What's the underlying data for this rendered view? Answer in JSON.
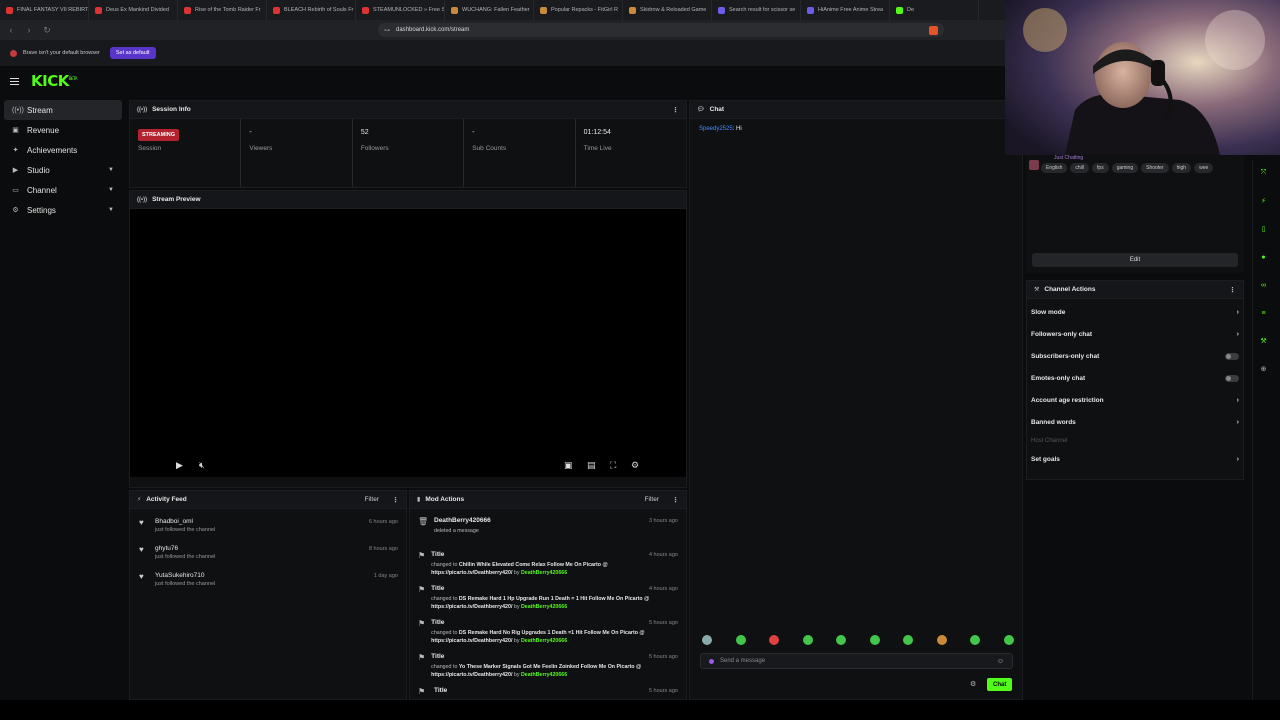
{
  "browser": {
    "tabs": [
      {
        "label": "FINAL FANTASY VII REBIRT",
        "color": "#d33"
      },
      {
        "label": "Deus Ex Mankind Divided",
        "color": "#d33"
      },
      {
        "label": "Rise of the Tomb Raider Fr",
        "color": "#d33"
      },
      {
        "label": "BLEACH Rebirth of Souls Fr",
        "color": "#d33"
      },
      {
        "label": "STEAMUNLOCKED » Free S",
        "color": "#d33"
      },
      {
        "label": "WUCHANG: Fallen Feather",
        "color": "#c98a3a"
      },
      {
        "label": "Popular Repacks - FitGirl R",
        "color": "#c98a3a"
      },
      {
        "label": "Skidrow & Reloaded Game",
        "color": "#c98a3a"
      },
      {
        "label": "Search result for scissor se",
        "color": "#6c5ce7"
      },
      {
        "label": "HiAnime Free Anime Strea",
        "color": "#6c5ce7"
      },
      {
        "label": "De",
        "color": "#53fc18"
      }
    ],
    "url": "dashboard.kick.com/stream",
    "notice": "Brave isn't your default browser",
    "set_default": "Set as default"
  },
  "header": {
    "logo": "KICK",
    "logo_beta": "BETA"
  },
  "sidebar": {
    "items": [
      {
        "label": "Stream",
        "icon": "broadcast-icon",
        "glyph": "((•))",
        "active": true,
        "chevron": false
      },
      {
        "label": "Revenue",
        "icon": "wallet-icon",
        "glyph": "▣",
        "active": false,
        "chevron": false
      },
      {
        "label": "Achievements",
        "icon": "trophy-icon",
        "glyph": "✦",
        "active": false,
        "chevron": false
      },
      {
        "label": "Studio",
        "icon": "camera-icon",
        "glyph": "▶",
        "active": false,
        "chevron": true
      },
      {
        "label": "Channel",
        "icon": "tv-icon",
        "glyph": "▭",
        "active": false,
        "chevron": true
      },
      {
        "label": "Settings",
        "icon": "gear-icon",
        "glyph": "⚙",
        "active": false,
        "chevron": true
      }
    ]
  },
  "session": {
    "title": "Session Info",
    "stats": [
      {
        "value": "STREAMING",
        "label": "Session",
        "badge": true
      },
      {
        "value": "-",
        "label": "Viewers",
        "badge": false
      },
      {
        "value": "52",
        "label": "Followers",
        "badge": false
      },
      {
        "value": "-",
        "label": "Sub Counts",
        "badge": false
      },
      {
        "value": "01:12:54",
        "label": "Time Live",
        "badge": false
      }
    ]
  },
  "preview": {
    "title": "Stream Preview"
  },
  "activity": {
    "title": "Activity Feed",
    "filter": "Filter",
    "items": [
      {
        "name": "Bhadboi_oml",
        "sub": "just followed the channel",
        "time": "6 hours ago"
      },
      {
        "name": "ghytu76",
        "sub": "just followed the channel",
        "time": "8 hours ago"
      },
      {
        "name": "YutaSukehiro710",
        "sub": "just followed the channel",
        "time": "1 day ago"
      }
    ]
  },
  "mod": {
    "title": "Mod Actions",
    "filter": "Filter",
    "items": [
      {
        "name": "DeathBerry420666",
        "pre": "deleted a message",
        "text": "",
        "link": "",
        "by": "",
        "time": "3 hours ago"
      },
      {
        "name": "Title",
        "pre": "changed to ",
        "text": "Chillin While Elevated Come Relax Follow Me On Picarto @",
        "link": "https://picarto.tv/Deathberry420/",
        "by": "DeathBerry420666",
        "time": "4 hours ago"
      },
      {
        "name": "Title",
        "pre": "changed to ",
        "text": "DS Remake Hard 1 Hp Upgrade Run 1 Death = 1 Hit Follow Me On Picarto",
        "link": "@ https://picarto.tv/Deathberry420/",
        "by": "DeathBerry420666",
        "time": "4 hours ago"
      },
      {
        "name": "Title",
        "pre": "changed to ",
        "text": "DS Remake Hard No Rig Upgrades 1 Death =1 Hit Follow Me On Picarto @",
        "link": "https://picarto.tv/Deathberry420/",
        "by": "DeathBerry420666",
        "time": "5 hours ago"
      },
      {
        "name": "Title",
        "pre": "changed to ",
        "text": "Yo These Marker Signals Got Me Feelin Zoinked Follow Me On Picarto @",
        "link": "https://picarto.tv/Deathberry420/",
        "by": "DeathBerry420666",
        "time": "5 hours ago"
      },
      {
        "name": "Title",
        "pre": "",
        "text": "",
        "link": "",
        "by": "",
        "time": "5 hours ago"
      }
    ]
  },
  "chat": {
    "title": "Chat",
    "messages": [
      {
        "user": "Speedy2525",
        "text": "Hi"
      }
    ],
    "placeholder": "Send a message",
    "send": "Chat"
  },
  "stream_info": {
    "chatting": "Just Chatting",
    "tags": [
      "English",
      "chill",
      "fps",
      "gaming",
      "Shooter",
      "high",
      "wee"
    ],
    "edit": "Edit"
  },
  "channel_actions": {
    "title": "Channel Actions",
    "items": [
      {
        "label": "Slow mode",
        "control": "chevron"
      },
      {
        "label": "Followers-only chat",
        "control": "chevron"
      },
      {
        "label": "Subscribers-only chat",
        "control": "toggle"
      },
      {
        "label": "Emotes-only chat",
        "control": "toggle"
      },
      {
        "label": "Account age restriction",
        "control": "chevron"
      },
      {
        "label": "Banned words",
        "control": "chevron"
      },
      {
        "label": "Host Channel",
        "control": "dim"
      },
      {
        "label": "Set goals",
        "control": "chevron"
      }
    ]
  },
  "colors": {
    "brand": "#53fc18",
    "live": "#b3232f",
    "chat_user": "#3f8cff"
  }
}
